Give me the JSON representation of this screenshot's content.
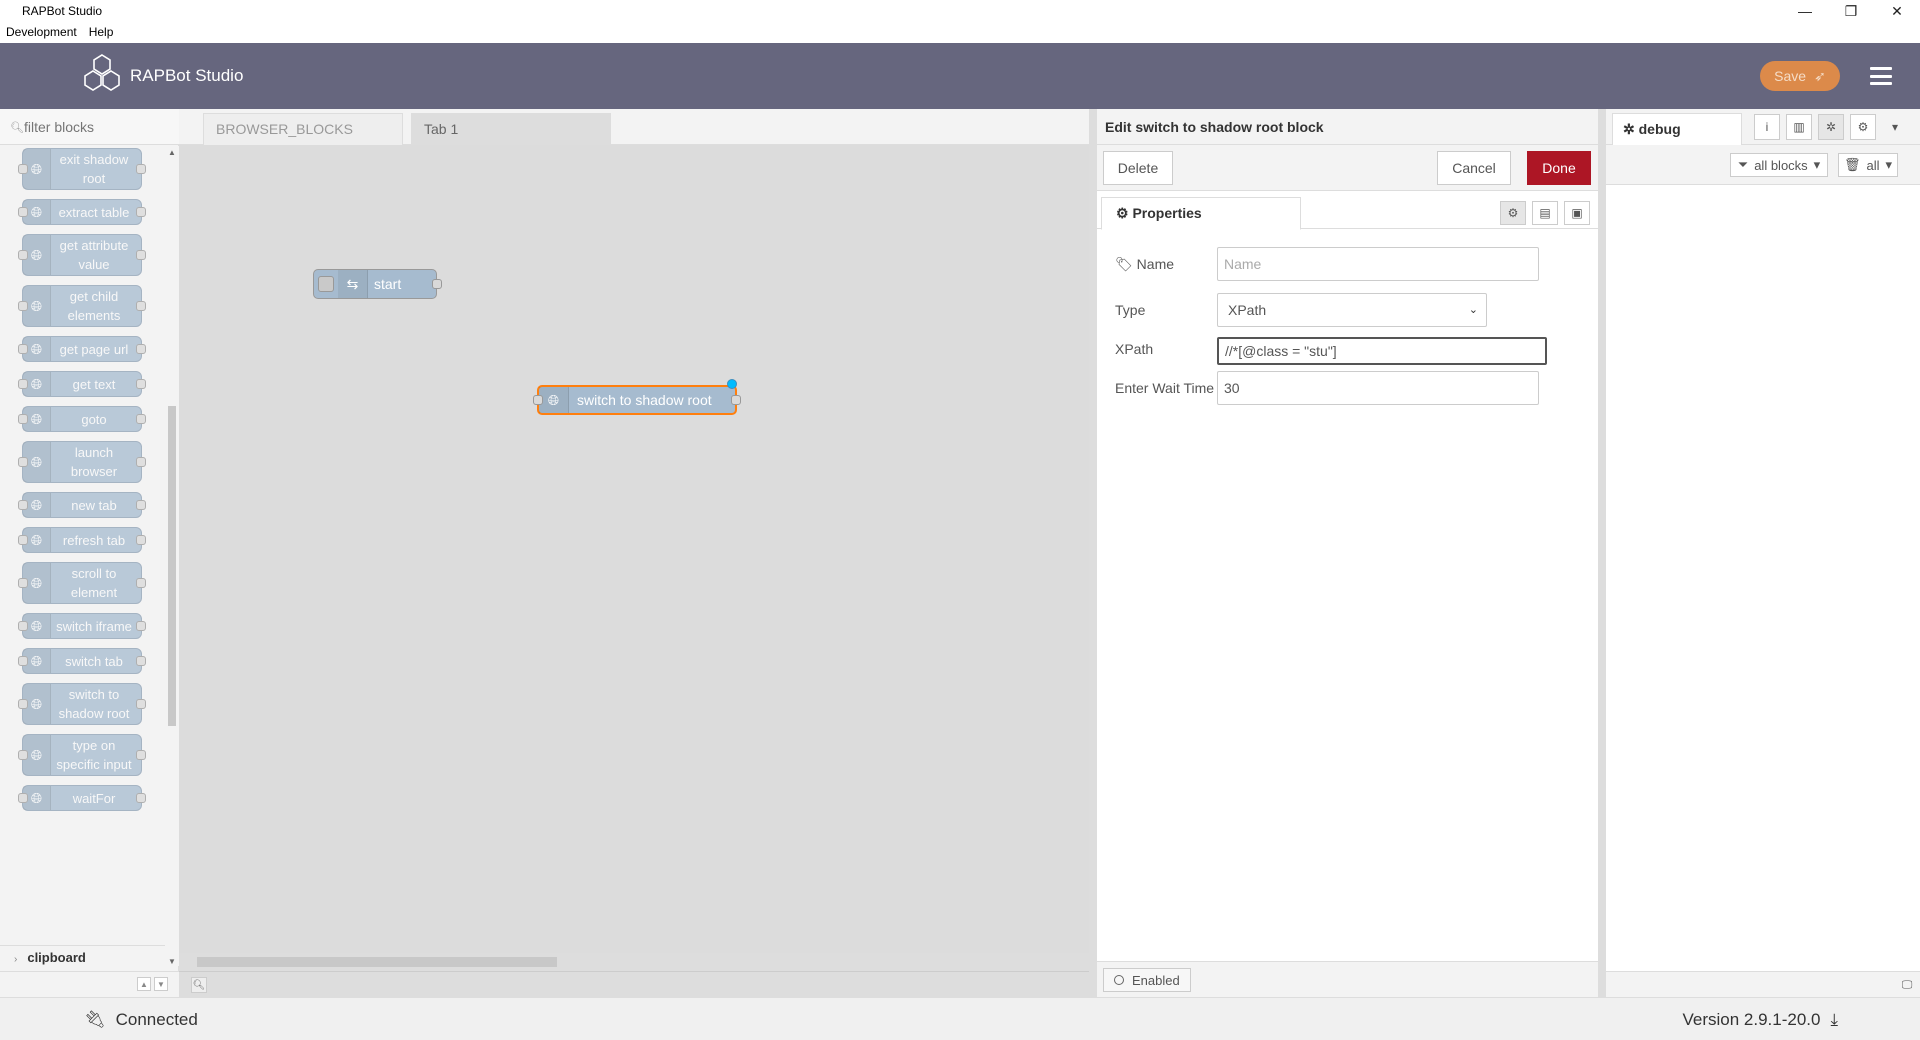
{
  "window": {
    "title": "RAPBot Studio",
    "menu": [
      "Development",
      "Help"
    ],
    "controls": [
      "minimize-icon",
      "restore-icon",
      "close-icon"
    ]
  },
  "header": {
    "app_name": "RAPBot Studio",
    "save_label": "Save",
    "colors": {
      "header_bg": "#66667e",
      "save_bg": "#dc8a4a"
    }
  },
  "palette": {
    "filter_placeholder": "filter blocks",
    "items": [
      "exit shadow root",
      "extract table",
      "get attribute value",
      "get child elements",
      "get page url",
      "get text",
      "goto",
      "launch browser",
      "new tab",
      "refresh tab",
      "scroll to element",
      "switch iframe",
      "switch tab",
      "switch to shadow root",
      "type on specific input",
      "waitFor"
    ],
    "category": "clipboard"
  },
  "workspace": {
    "tabs": [
      "BROWSER_BLOCKS",
      "Tab 1"
    ],
    "active_tab": "Tab 1",
    "nodes": [
      {
        "label": "start"
      },
      {
        "label": "switch to shadow root",
        "selected": true,
        "changed": true
      }
    ]
  },
  "tray": {
    "title": "Edit switch to shadow root block",
    "delete_label": "Delete",
    "cancel_label": "Cancel",
    "done_label": "Done",
    "properties_tab": "Properties",
    "fields": {
      "name_label": "Name",
      "name_placeholder": "Name",
      "name_value": "",
      "type_label": "Type",
      "type_value": "XPath",
      "xpath_label": "XPath",
      "xpath_value": "//*[@class = \"stu\"]",
      "wait_label": "Enter Wait Time",
      "wait_value": "30"
    },
    "enabled_label": "Enabled"
  },
  "sidebar": {
    "tab_label": "debug",
    "filter_label": "all blocks",
    "clear_label": "all"
  },
  "status": {
    "connection": "Connected",
    "version": "Version 2.9.1-20.0"
  }
}
